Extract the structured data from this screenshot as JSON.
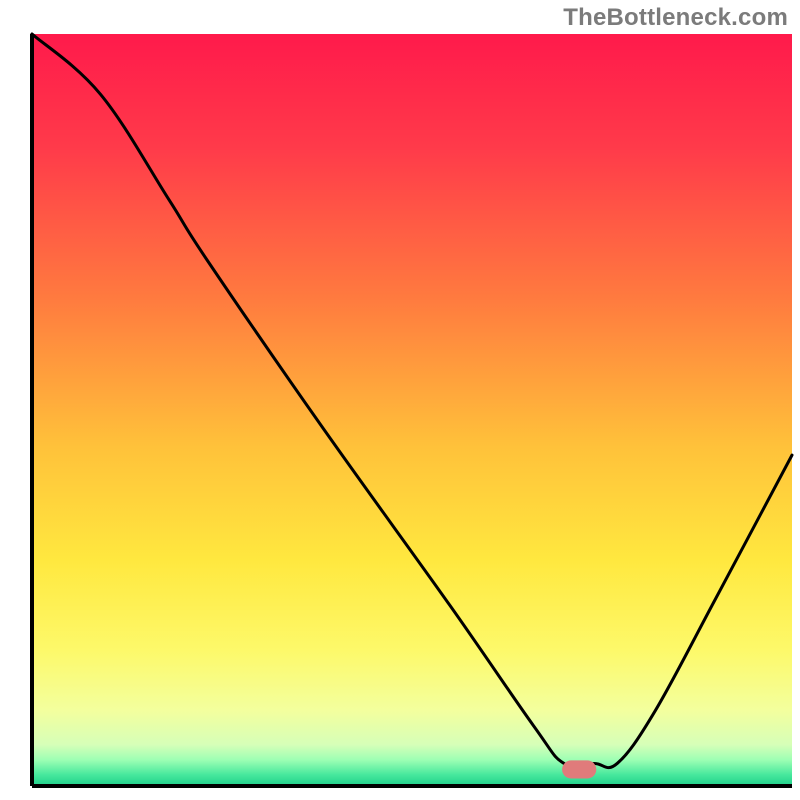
{
  "watermark": "TheBottleneck.com",
  "chart_data": {
    "type": "line",
    "title": "",
    "xlabel": "",
    "ylabel": "",
    "xlim": [
      0,
      100
    ],
    "ylim": [
      0,
      100
    ],
    "grid": false,
    "axes_visible": {
      "left": true,
      "bottom": true
    },
    "background_gradient": {
      "type": "vertical",
      "stops": [
        {
          "offset": 0.0,
          "color": "#ff1a4b"
        },
        {
          "offset": 0.15,
          "color": "#ff3a4a"
        },
        {
          "offset": 0.35,
          "color": "#ff7a3f"
        },
        {
          "offset": 0.55,
          "color": "#ffc23a"
        },
        {
          "offset": 0.7,
          "color": "#ffe83f"
        },
        {
          "offset": 0.82,
          "color": "#fdf96a"
        },
        {
          "offset": 0.9,
          "color": "#f3ff9e"
        },
        {
          "offset": 0.945,
          "color": "#d6ffb8"
        },
        {
          "offset": 0.965,
          "color": "#9effb4"
        },
        {
          "offset": 0.985,
          "color": "#47e89d"
        },
        {
          "offset": 1.0,
          "color": "#1fcf8a"
        }
      ]
    },
    "series": [
      {
        "name": "bottleneck-curve",
        "color": "#000000",
        "x": [
          0,
          9,
          18,
          23,
          38,
          55,
          66,
          70,
          74,
          77,
          82,
          90,
          100
        ],
        "y": [
          100,
          92,
          78,
          70,
          48,
          24,
          8,
          3,
          3,
          3,
          10,
          25,
          44
        ]
      }
    ],
    "markers": [
      {
        "name": "optimal-point",
        "shape": "rounded-rect",
        "x": 72,
        "y": 2.2,
        "width_units": 4.5,
        "height_units": 2.4,
        "color": "#e07b7b"
      }
    ]
  }
}
